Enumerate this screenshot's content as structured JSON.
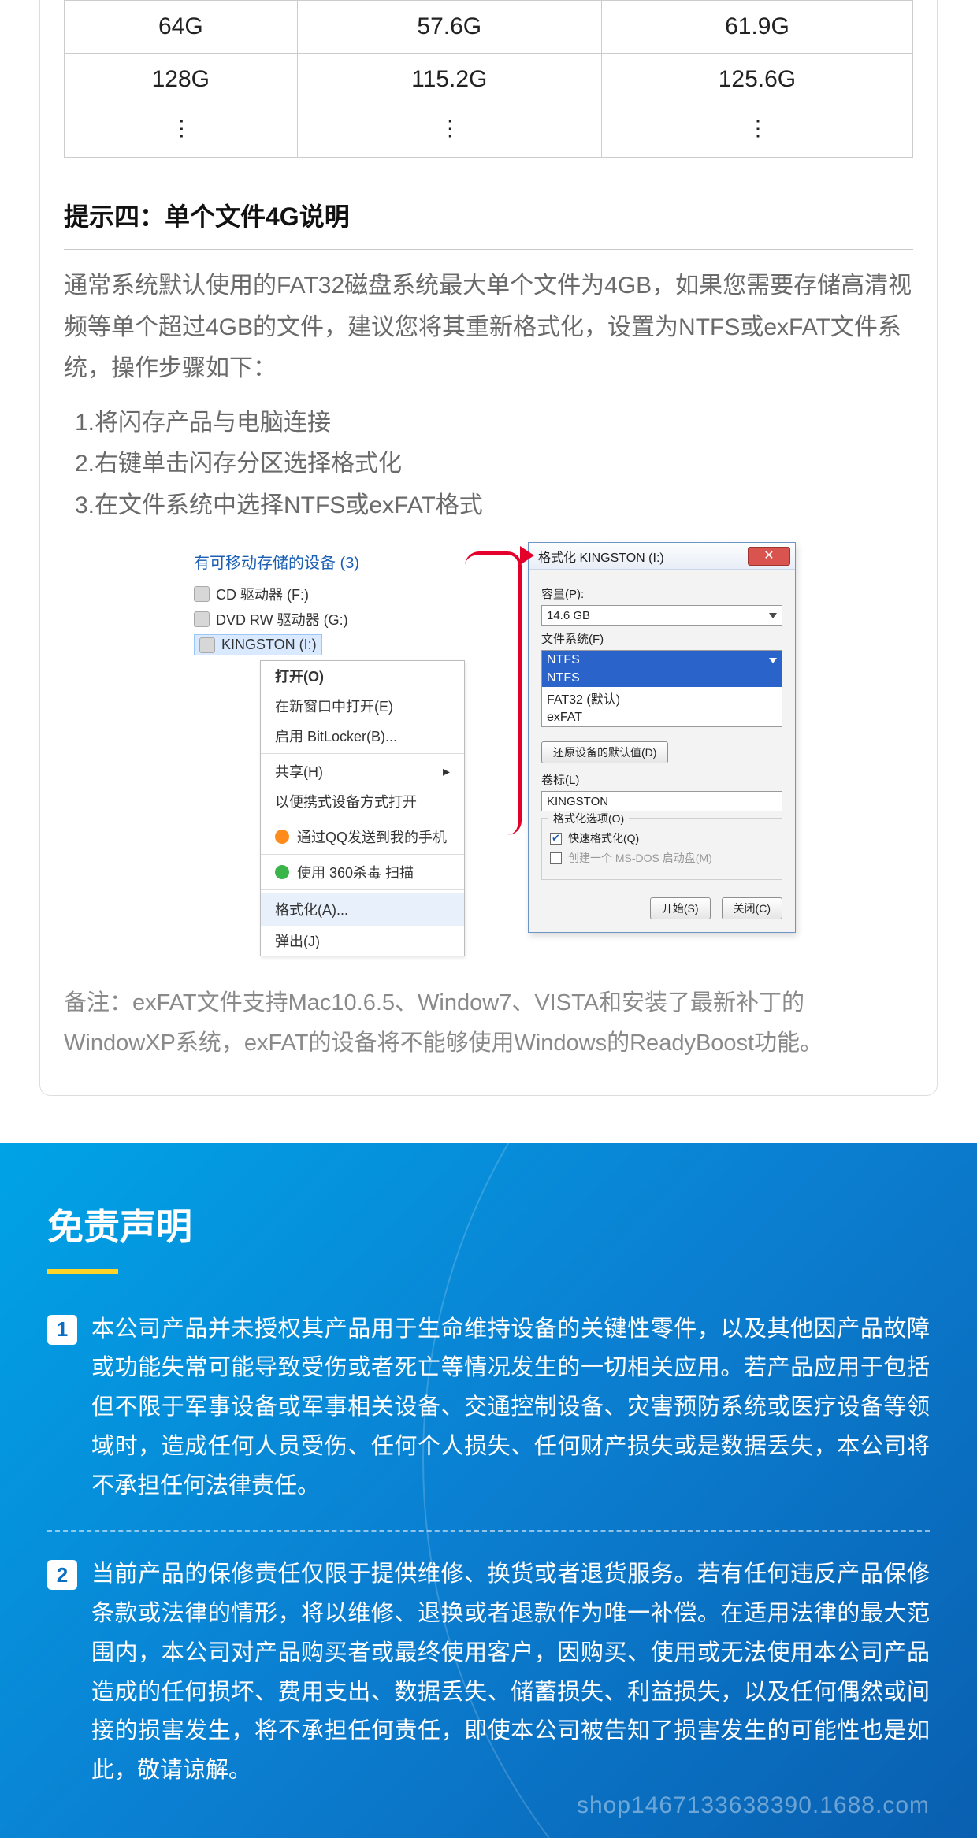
{
  "table": {
    "rows": [
      {
        "c1": "64G",
        "c2": "57.6G",
        "c3": "61.9G"
      },
      {
        "c1": "128G",
        "c2": "115.2G",
        "c3": "125.6G"
      }
    ],
    "vdots": "⋮"
  },
  "tip4": {
    "title": "提示四：单个文件4G说明",
    "body": "通常系统默认使用的FAT32磁盘系统最大单个文件为4GB，如果您需要存储高清视频等单个超过4GB的文件，建议您将其重新格式化，设置为NTFS或exFAT文件系统，操作步骤如下：",
    "step1": "1.将闪存产品与电脑连接",
    "step2": "2.右键单击闪存分区选择格式化",
    "step3": "3.在文件系统中选择NTFS或exFAT格式",
    "note": "备注：exFAT文件支持Mac10.6.5、Window7、VISTA和安装了最新补丁的WindowXP系统，exFAT的设备将不能够使用Windows的ReadyBoost功能。"
  },
  "explorer": {
    "header": "有可移动存储的设备 (3)",
    "dev1": "CD 驱动器 (F:)",
    "dev2": "DVD RW 驱动器 (G:)",
    "dev3": "KINGSTON (I:)"
  },
  "ctx": {
    "open": "打开(O)",
    "newwin": "在新窗口中打开(E)",
    "bitlocker": "启用 BitLocker(B)...",
    "share": "共享(H)",
    "portable": "以便携式设备方式打开",
    "qq": "通过QQ发送到我的手机",
    "av": "使用 360杀毒 扫描",
    "format": "格式化(A)...",
    "eject": "弹出(J)"
  },
  "dialog": {
    "title": "格式化 KINGSTON (I:)",
    "cap_label": "容量(P):",
    "cap_value": "14.6 GB",
    "fs_label": "文件系统(F)",
    "fs_selected": "NTFS",
    "fs_opt1": "NTFS",
    "fs_opt2": "FAT32 (默认)",
    "fs_opt3": "exFAT",
    "restore": "还原设备的默认值(D)",
    "vol_label": "卷标(L)",
    "vol_value": "KINGSTON",
    "group": "格式化选项(O)",
    "quick": "快速格式化(Q)",
    "msdos": "创建一个 MS-DOS 启动盘(M)",
    "start": "开始(S)",
    "close": "关闭(C)"
  },
  "disclaimer": {
    "title": "免责声明",
    "n1": "1",
    "p1": "本公司产品并未授权其产品用于生命维持设备的关键性零件，以及其他因产品故障或功能失常可能导致受伤或者死亡等情况发生的一切相关应用。若产品应用于包括但不限于军事设备或军事相关设备、交通控制设备、灾害预防系统或医疗设备等领域时，造成任何人员受伤、任何个人损失、任何财产损失或是数据丢失，本公司将不承担任何法律责任。",
    "n2": "2",
    "p2": "当前产品的保修责任仅限于提供维修、换货或者退货服务。若有任何违反产品保修条款或法律的情形，将以维修、退换或者退款作为唯一补偿。在适用法律的最大范围内，本公司对产品购买者或最终使用客户，因购买、使用或无法使用本公司产品造成的任何损坏、费用支出、数据丢失、储蓄损失、利益损失，以及任何偶然或间接的损害发生，将不承担任何责任，即使本公司被告知了损害发生的可能性也是如此，敬请谅解。",
    "watermark": "shop1467133638390.1688.com"
  }
}
